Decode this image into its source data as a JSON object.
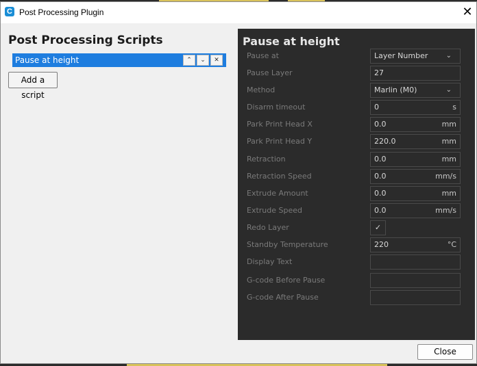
{
  "window": {
    "app_icon": "cura-logo-icon",
    "app_icon_glyph": "C",
    "title": "Post Processing Plugin",
    "close_glyph": "✕"
  },
  "left": {
    "title": "Post Processing Scripts",
    "scripts": [
      {
        "label": "Pause at height",
        "selected": true
      }
    ],
    "move_up_glyph": "⌃",
    "move_down_glyph": "⌄",
    "remove_glyph": "✕",
    "add_button": "Add a script"
  },
  "panel": {
    "title": "Pause at height",
    "settings": [
      {
        "label": "Pause at",
        "type": "select",
        "value": "Layer Number",
        "unit": ""
      },
      {
        "label": "Pause Layer",
        "type": "text",
        "value": "27",
        "unit": ""
      },
      {
        "label": "Method",
        "type": "select",
        "value": "Marlin (M0)",
        "unit": ""
      },
      {
        "label": "Disarm timeout",
        "type": "text",
        "value": "0",
        "unit": "s"
      },
      {
        "label": "Park Print Head X",
        "type": "text",
        "value": "0.0",
        "unit": "mm"
      },
      {
        "label": "Park Print Head Y",
        "type": "text",
        "value": "220.0",
        "unit": "mm"
      },
      {
        "label": "Retraction",
        "type": "text",
        "value": "0.0",
        "unit": "mm"
      },
      {
        "label": "Retraction Speed",
        "type": "text",
        "value": "0.0",
        "unit": "mm/s"
      },
      {
        "label": "Extrude Amount",
        "type": "text",
        "value": "0.0",
        "unit": "mm"
      },
      {
        "label": "Extrude Speed",
        "type": "text",
        "value": "0.0",
        "unit": "mm/s"
      },
      {
        "label": "Redo Layer",
        "type": "checkbox",
        "value": "✓",
        "unit": ""
      },
      {
        "label": "Standby Temperature",
        "type": "text",
        "value": "220",
        "unit": "°C"
      },
      {
        "label": "Display Text",
        "type": "text",
        "value": "",
        "unit": ""
      },
      {
        "label": "G-code Before Pause",
        "type": "text",
        "value": "",
        "unit": ""
      },
      {
        "label": "G-code After Pause",
        "type": "text",
        "value": "",
        "unit": ""
      }
    ],
    "select_chevron": "⌄"
  },
  "footer": {
    "close_button": "Close"
  },
  "colors": {
    "accent": "#1e7ddf",
    "panel_bg": "#2b2b2b",
    "label_text": "#7a7a7a"
  }
}
